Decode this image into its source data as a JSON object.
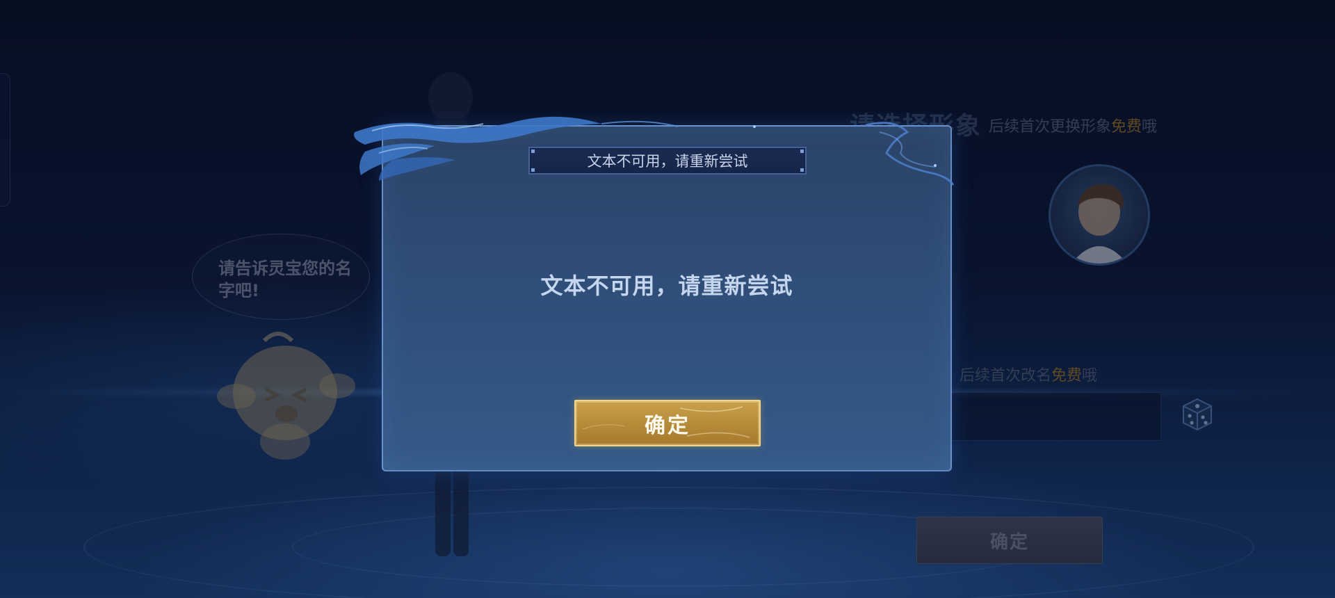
{
  "background": {
    "speech_bubble_text": "请告诉灵宝您的名字吧!",
    "select_avatar_title": "请选择形象",
    "select_avatar_hint_prefix": "后续首次更换形象",
    "select_avatar_hint_free": "免费",
    "select_avatar_hint_suffix": "哦",
    "rename_hint_prefix": "后续首次改名",
    "rename_hint_free": "免费",
    "rename_hint_suffix": "哦",
    "name_input_value": "",
    "confirm_label": "确定"
  },
  "dialog": {
    "title": "文本不可用，请重新尝试",
    "message": "文本不可用，请重新尝试",
    "confirm_label": "确定"
  },
  "icons": {
    "dice": "dice-icon",
    "mascot": "mascot-icon"
  },
  "colors": {
    "dialog_border": "#78a5e1",
    "confirm_gold": "#c9a24e",
    "free_highlight": "#a0782c"
  }
}
